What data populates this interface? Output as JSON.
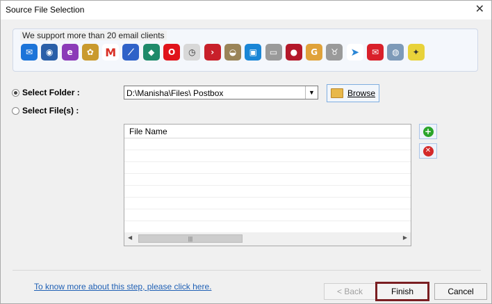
{
  "window": {
    "title": "Source File Selection",
    "close_glyph": "✕"
  },
  "clients": {
    "label": "We support more than 20 email clients",
    "icons": [
      {
        "name": "mail-icon",
        "color": "#1c74d9",
        "glyph": "✉"
      },
      {
        "name": "thunderbird-icon",
        "color": "#2a5fa8",
        "glyph": "◉"
      },
      {
        "name": "eudora-icon",
        "color": "#8b3bb8",
        "glyph": "e"
      },
      {
        "name": "seamonkey-icon",
        "color": "#c99a2e",
        "glyph": "✿"
      },
      {
        "name": "gmail-icon",
        "color": "#ffffff",
        "glyph": "M"
      },
      {
        "name": "postbox-icon",
        "color": "#2f62c8",
        "glyph": "⟋"
      },
      {
        "name": "mailbird-icon",
        "color": "#1e8a6a",
        "glyph": "◆"
      },
      {
        "name": "opera-icon",
        "color": "#e0131b",
        "glyph": "O"
      },
      {
        "name": "time-mail-icon",
        "color": "#d8d8d8",
        "glyph": "◷"
      },
      {
        "name": "arrow-mail-icon",
        "color": "#c8202a",
        "glyph": "›"
      },
      {
        "name": "landscape-icon",
        "color": "#9a8458",
        "glyph": "◒"
      },
      {
        "name": "windows-mail-icon",
        "color": "#1a86d6",
        "glyph": "▣"
      },
      {
        "name": "monitor-mail-icon",
        "color": "#9a9a9a",
        "glyph": "▭"
      },
      {
        "name": "berries-icon",
        "color": "#b4182a",
        "glyph": "●"
      },
      {
        "name": "g-icon",
        "color": "#e0a23a",
        "glyph": "G"
      },
      {
        "name": "gnu-icon",
        "color": "#9a9a9a",
        "glyph": "♉"
      },
      {
        "name": "paper-plane-icon",
        "color": "#ffffff",
        "glyph": "➤"
      },
      {
        "name": "envelope-red-icon",
        "color": "#d9202a",
        "glyph": "✉"
      },
      {
        "name": "globe-mail-icon",
        "color": "#7d9ab8",
        "glyph": "◍"
      },
      {
        "name": "bat-icon",
        "color": "#e8d23a",
        "glyph": "✦"
      }
    ]
  },
  "source": {
    "folder_label": "Select Folder :",
    "files_label": "Select File(s) :",
    "folder_path": "D:\\Manisha\\Files\\ Postbox",
    "browse_label": "Browse"
  },
  "file_grid": {
    "column_header": "File Name",
    "rows": []
  },
  "footer": {
    "help_link": "To know more about this step, please click here.",
    "back_label": "< Back",
    "finish_label": "Finish",
    "cancel_label": "Cancel"
  },
  "colors": {
    "accent_border": "#7a1e22",
    "link": "#1e5fb4",
    "add_green": "#2aa52a",
    "remove_red": "#d42a2a"
  }
}
